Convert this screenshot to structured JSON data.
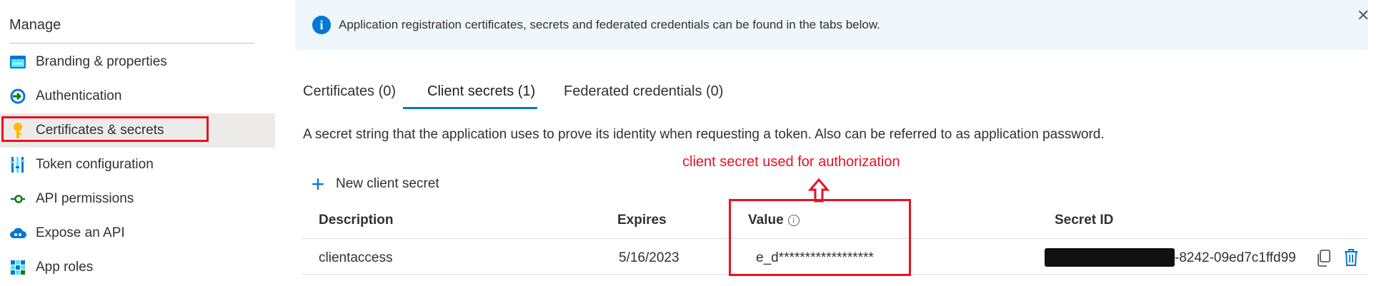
{
  "sidebar": {
    "section_title": "Manage",
    "items": [
      {
        "label": "Branding & properties",
        "icon": "branding-icon"
      },
      {
        "label": "Authentication",
        "icon": "authentication-icon"
      },
      {
        "label": "Certificates & secrets",
        "icon": "key-icon",
        "selected": true
      },
      {
        "label": "Token configuration",
        "icon": "token-configuration-icon"
      },
      {
        "label": "API permissions",
        "icon": "api-permissions-icon"
      },
      {
        "label": "Expose an API",
        "icon": "cloud-icon"
      },
      {
        "label": "App roles",
        "icon": "app-roles-icon"
      }
    ]
  },
  "banner": {
    "text": "Application registration certificates, secrets and federated credentials can be found in the tabs below.",
    "icon": "info-icon",
    "close_icon": "close-icon"
  },
  "tabs": [
    {
      "label": "Certificates (0)"
    },
    {
      "label": "Client secrets (1)",
      "selected": true
    },
    {
      "label": "Federated credentials (0)"
    }
  ],
  "description": "A secret string that the application uses to prove its identity when requesting a token. Also can be referred to as application password.",
  "annotation": {
    "text": "client secret used for authorization",
    "color": "#e81123"
  },
  "new_secret_button": {
    "label": "New client secret",
    "icon": "plus-icon"
  },
  "table": {
    "headers": {
      "description": "Description",
      "expires": "Expires",
      "value": "Value",
      "secret_id": "Secret ID"
    },
    "rows": [
      {
        "description": "clientaccess",
        "expires": "5/16/2023",
        "value": "e_d******************",
        "secret_id": "-8242-09ed7c1ffd99"
      }
    ]
  },
  "colors": {
    "accent": "#0078d4",
    "highlight_box": "#e81123",
    "banner_bg": "#eff6fc",
    "selected_nav_bg": "#edebe9"
  }
}
